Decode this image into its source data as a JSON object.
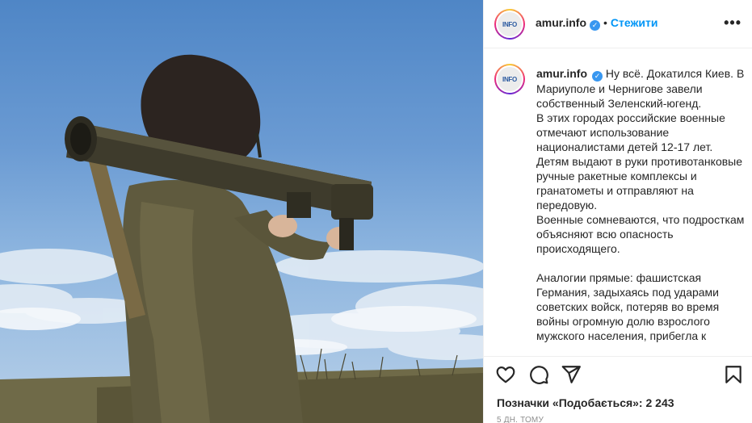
{
  "post": {
    "username": "amur.info",
    "avatar_text": "INFO",
    "follow_label": "Стежити",
    "separator": "•",
    "more_icon": "more-horizontal-icon",
    "caption_paragraphs": [
      "Ну всё. Докатился Киев. В Мариуполе и Чернигове завели собственный Зеленский-югенд.",
      "В этих городах российские военные отмечают использование националистами детей 12-17 лет.",
      "Детям выдают в руки противотанковые ручные ракетные комплексы и гранатометы и отправляют на передовую.",
      "Военные сомневаются, что подросткам объясняют всю опасность происходящего."
    ],
    "caption_paragraph2": "Аналогии прямые: фашистская Германия, задыхаясь под ударами советских войск, потеряв во время войны огромную долю взрослого мужского населения, прибегла к",
    "likes_text": "Позначки «Подобається»: 2 243",
    "time_text": "5 дн. тому"
  },
  "colors": {
    "accent": "#0095f6",
    "verified": "#3897f0",
    "text": "#262626",
    "muted": "#8e8e8e"
  }
}
